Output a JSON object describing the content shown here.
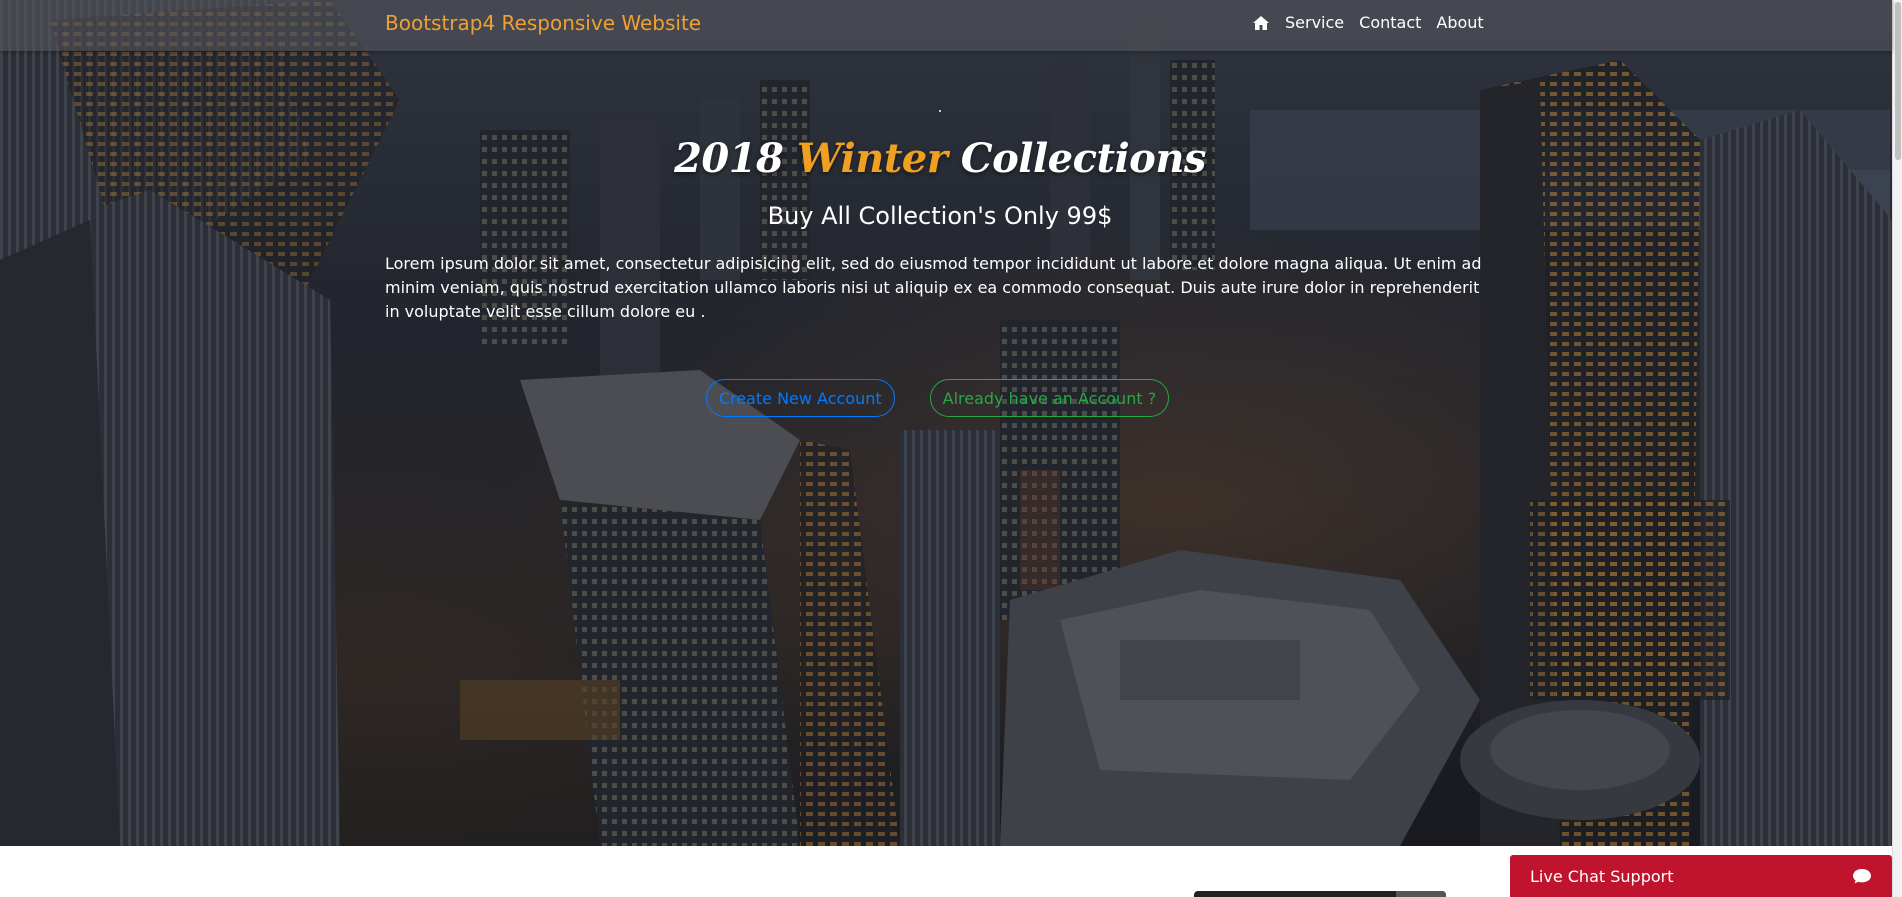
{
  "navbar": {
    "brand": "Bootstrap4 Responsive Website",
    "home_icon": "home-icon",
    "links": [
      "Service",
      "Contact",
      "About"
    ]
  },
  "hero": {
    "title_part1": "2018",
    "title_accent": "Winter",
    "title_part2": "Collections",
    "subtitle": "Buy All Collection's Only 99$",
    "body": "Lorem ipsum dolor sit amet, consectetur adipisicing elit, sed do eiusmod tempor incididunt ut labore et dolore magna aliqua. Ut enim ad minim veniam, quis nostrud exercitation ullamco laboris nisi ut aliquip ex ea commodo consequat. Duis aute irure dolor in reprehenderit in voluptate velit esse cillum dolore eu .",
    "create_button": "Create New Account",
    "login_button": "Already have an Account ?"
  },
  "live_chat": {
    "label": "Live Chat Support",
    "icon": "chat-bubble-icon"
  },
  "colors": {
    "brand": "#f0a030",
    "accent": "#f0a020",
    "primary": "#007bff",
    "success": "#28a745",
    "chat": "#c0142e"
  }
}
